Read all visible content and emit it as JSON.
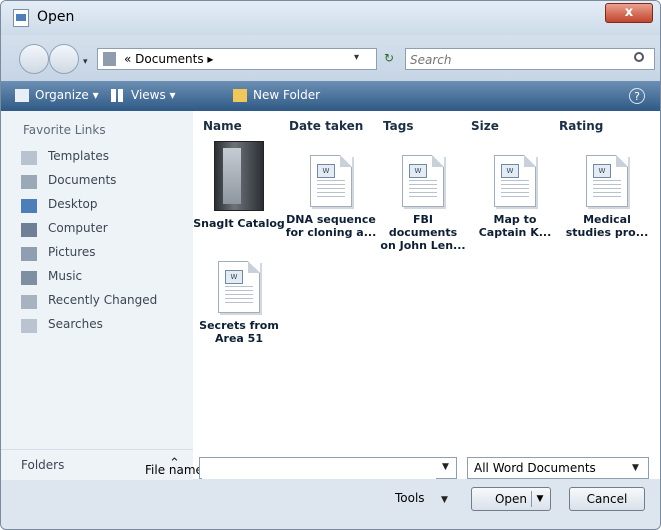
{
  "window": {
    "title": "Open",
    "close_label": "x"
  },
  "address": {
    "path": "« Documents ▸",
    "search_placeholder": "Search"
  },
  "toolbar": {
    "organize": "Organize ▾",
    "views": "Views ▾",
    "new_folder": "New Folder",
    "help": "?"
  },
  "left_pane": {
    "favorites_title": "Favorite Links",
    "items": [
      {
        "label": "Templates",
        "icon": "templates-icon"
      },
      {
        "label": "Documents",
        "icon": "documents-icon"
      },
      {
        "label": "Desktop",
        "icon": "desktop-icon"
      },
      {
        "label": "Computer",
        "icon": "computer-icon"
      },
      {
        "label": "Pictures",
        "icon": "pictures-icon"
      },
      {
        "label": "Music",
        "icon": "music-icon"
      },
      {
        "label": "Recently Changed",
        "icon": "recently-changed-icon"
      },
      {
        "label": "Searches",
        "icon": "searches-icon"
      }
    ],
    "folders_label": "Folders",
    "folders_chevron": "⌃"
  },
  "columns": [
    "Name",
    "Date taken",
    "Tags",
    "Size",
    "Rating"
  ],
  "files": [
    {
      "name_line1": "SnagIt Catalog",
      "name_line2": "",
      "kind": "folder"
    },
    {
      "name_line1": "DNA sequence",
      "name_line2": "for cloning a...",
      "kind": "doc"
    },
    {
      "name_line1": "FBI documents",
      "name_line2": "on John Len...",
      "kind": "doc"
    },
    {
      "name_line1": "Map to",
      "name_line2": "Captain K...",
      "kind": "doc"
    },
    {
      "name_line1": "Medical",
      "name_line2": "studies pro...",
      "kind": "doc"
    },
    {
      "name_line1": "Secrets from",
      "name_line2": "Area 51",
      "kind": "doc"
    }
  ],
  "doc_badge": "W",
  "bottom": {
    "filename_label": "File name:",
    "filename_value": "",
    "filter_value": "All Word Documents",
    "tools_label": "Tools",
    "open_label": "Open",
    "cancel_label": "Cancel"
  },
  "colors": {
    "toolbar_top": "#6c8fb3",
    "toolbar_bottom": "#2f5a86",
    "close_red": "#c2452e"
  }
}
